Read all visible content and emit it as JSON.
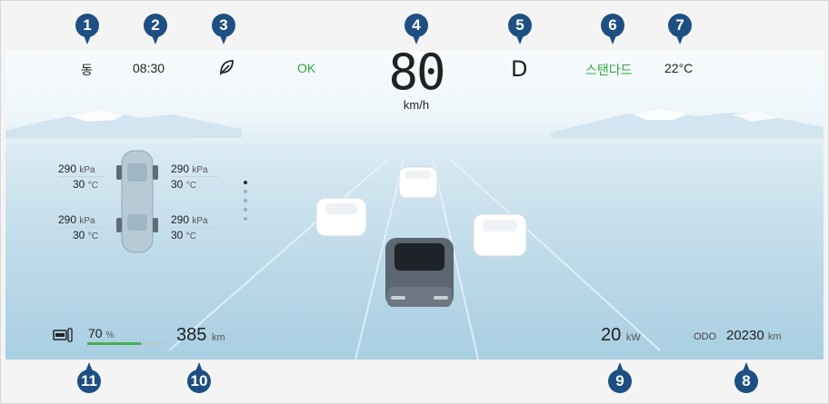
{
  "markers": [
    "1",
    "2",
    "3",
    "4",
    "5",
    "6",
    "7",
    "8",
    "9",
    "10",
    "11"
  ],
  "top_bar": {
    "direction": "동",
    "time": "08:30",
    "eco_icon": "leaf-icon",
    "status": "OK",
    "speed": "80",
    "speed_unit": "km/h",
    "gear": "D",
    "drive_mode": "스탠다드",
    "temperature": "22°C"
  },
  "tires": {
    "front_left": {
      "pressure": "290",
      "pressure_unit": "kPa",
      "temp": "30",
      "temp_unit": "°C"
    },
    "front_right": {
      "pressure": "290",
      "pressure_unit": "kPa",
      "temp": "30",
      "temp_unit": "°C"
    },
    "rear_left": {
      "pressure": "290",
      "pressure_unit": "kPa",
      "temp": "30",
      "temp_unit": "°C"
    },
    "rear_right": {
      "pressure": "290",
      "pressure_unit": "kPa",
      "temp": "30",
      "temp_unit": "°C"
    }
  },
  "bottom_bar": {
    "battery_icon": "battery-icon",
    "battery_value": "70",
    "battery_unit": "%",
    "battery_level": 0.7,
    "range_value": "385",
    "range_unit": "km",
    "power_value": "20",
    "power_unit": "kW",
    "odo_label": "ODO",
    "odo_value": "20230",
    "odo_unit": "km"
  },
  "colors": {
    "marker": "#1e4f82",
    "accent_green": "#35a843",
    "battery_bar": "#4caf50"
  }
}
